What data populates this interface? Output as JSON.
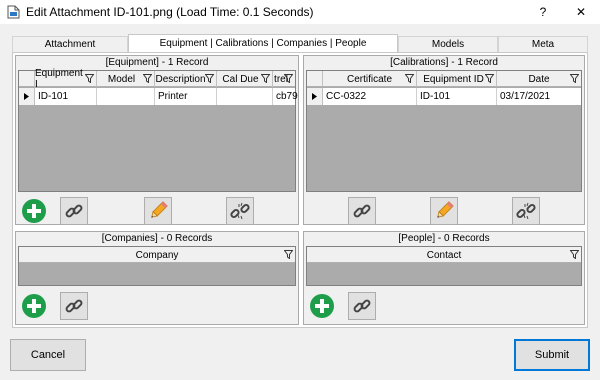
{
  "window": {
    "title": "Edit Attachment ID-101.png (Load Time: 0.1 Seconds)",
    "help_label": "?",
    "close_label": "✕"
  },
  "tabs": [
    {
      "label": "Attachment"
    },
    {
      "label": "Equipment | Calibrations | Companies | People"
    },
    {
      "label": "Models"
    },
    {
      "label": "Meta"
    }
  ],
  "equipment": {
    "title": "[Equipment] - 1 Record",
    "columns": [
      "Equipment I",
      "Model",
      "Description",
      "Cal Due",
      "trel"
    ],
    "rows": [
      [
        "ID-101",
        "",
        "Printer",
        "",
        "cb79"
      ]
    ]
  },
  "calibrations": {
    "title": "[Calibrations] - 1 Record",
    "columns": [
      "Certificate",
      "Equipment ID",
      "Date"
    ],
    "rows": [
      [
        "CC-0322",
        "ID-101",
        "03/17/2021"
      ]
    ]
  },
  "companies": {
    "title": "[Companies] - 0 Records",
    "columns": [
      "Company"
    ]
  },
  "people": {
    "title": "[People] - 0 Records",
    "columns": [
      "Contact"
    ]
  },
  "buttons": {
    "cancel": "Cancel",
    "submit": "Submit"
  },
  "colors": {
    "accent": "#0078d7",
    "add_green": "#1e9e4a",
    "pencil_orange": "#f5a623"
  }
}
